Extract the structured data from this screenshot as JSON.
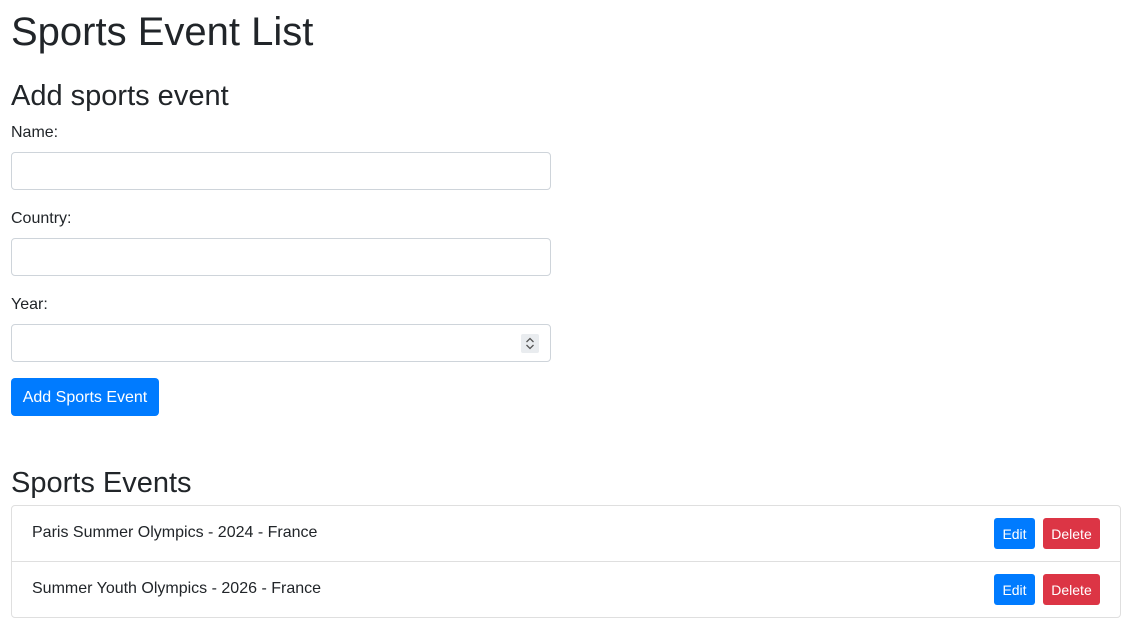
{
  "page": {
    "title": "Sports Event List"
  },
  "form": {
    "title": "Add sports event",
    "name_label": "Name:",
    "name_value": "",
    "country_label": "Country:",
    "country_value": "",
    "year_label": "Year:",
    "year_value": "",
    "submit_label": "Add Sports Event"
  },
  "list": {
    "title": "Sports Events",
    "items": [
      {
        "text": "Paris Summer Olympics - 2024 - France",
        "edit_label": "Edit",
        "delete_label": "Delete"
      },
      {
        "text": "Summer Youth Olympics - 2026 - France",
        "edit_label": "Edit",
        "delete_label": "Delete"
      }
    ]
  },
  "colors": {
    "primary": "#007bff",
    "danger": "#dc3545",
    "text": "#212529",
    "border": "#ced4da"
  },
  "icons": {
    "year_spinner": "spinner-arrows-icon"
  }
}
